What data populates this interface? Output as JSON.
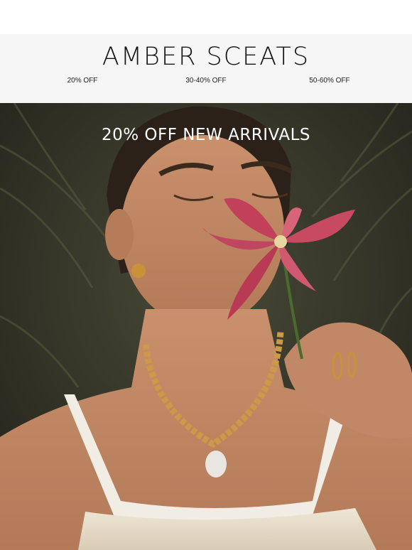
{
  "brand": {
    "name": "AMBER SCEATS"
  },
  "nav": {
    "items": [
      {
        "label": "20% OFF"
      },
      {
        "label": "30-40% OFF"
      },
      {
        "label": "50-60% OFF"
      }
    ]
  },
  "hero": {
    "headline": "20% OFF NEW ARRIVALS"
  },
  "colors": {
    "header_bg": "#f6f6f6",
    "text": "#151515",
    "headline": "#ffffff"
  }
}
